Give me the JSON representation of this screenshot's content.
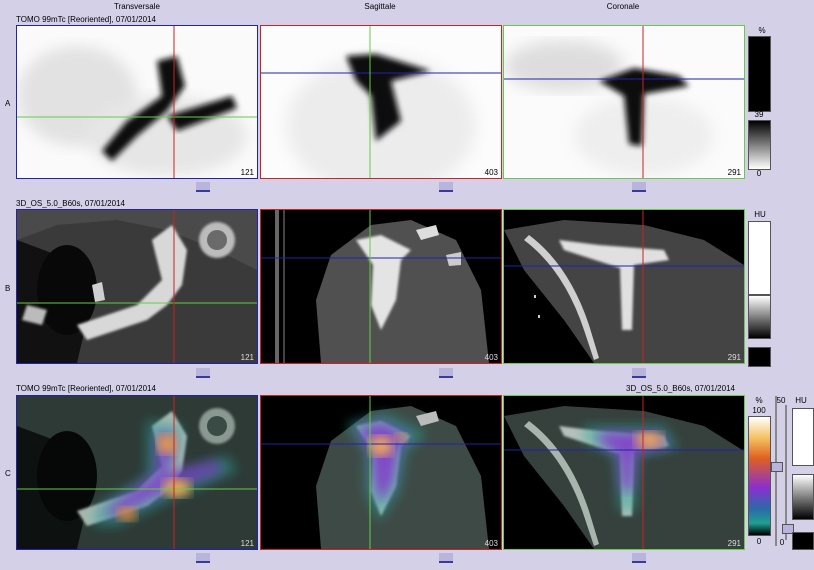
{
  "columns": {
    "transverse": "Transversale",
    "sagittal": "Sagittale",
    "coronal": "Coronale"
  },
  "rows": {
    "a": {
      "letter": "A",
      "caption": "TOMO 99mTc [Reoriented], 07/01/2014",
      "slices": [
        "121",
        "403",
        "291"
      ]
    },
    "b": {
      "letter": "B",
      "caption": "3D_OS_5.0_B60s, 07/01/2014",
      "slices": [
        "121",
        "403",
        "291"
      ]
    },
    "c": {
      "letter": "C",
      "caption": "TOMO 99mTc [Reoriented], 07/01/2014",
      "caption_right": "3D_OS_5.0_B60s, 07/01/2014",
      "slices": [
        "121",
        "403",
        "291"
      ]
    }
  },
  "scales": {
    "a": {
      "unit": "%",
      "mid": "39",
      "bottom": "0"
    },
    "b": {
      "unit": "HU"
    },
    "c": {
      "unit_pct": "%",
      "unit_hu": "HU",
      "top": "100",
      "bottom": "0",
      "level": "50",
      "level_bottom": "0"
    }
  },
  "colors": {
    "frame_bg": "#d4d0e8",
    "transverse_border": "#2222aa",
    "sagittal_border": "#cc2222",
    "coronal_border": "#66cc44"
  }
}
